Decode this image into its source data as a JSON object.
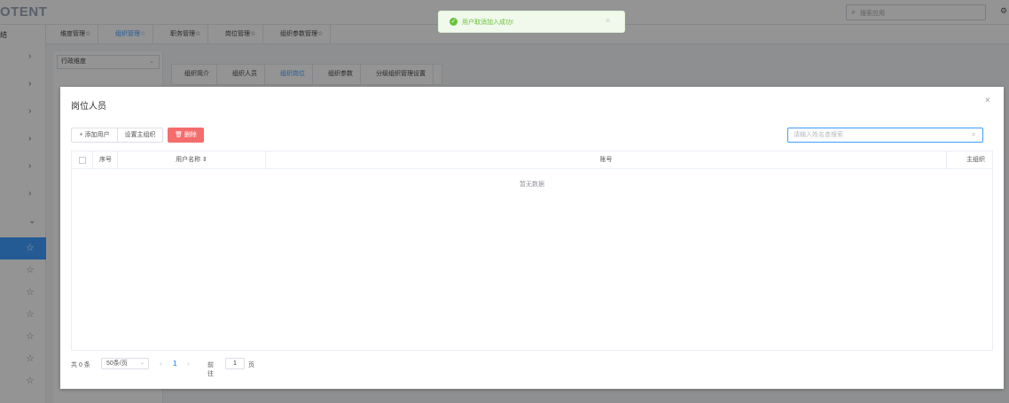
{
  "app": {
    "brand": "OTENT",
    "search_placeholder": "搜索应用",
    "sidebar_head": "结"
  },
  "tabs": [
    "维度管理☆",
    "组织管理☆",
    "职务管理☆",
    "岗位管理☆",
    "组织参数管理☆"
  ],
  "tabs_active": 1,
  "tree": {
    "select_value": "行政维度"
  },
  "inner_tabs": [
    "组织简介",
    "组织人员",
    "组织岗位",
    "组织参数",
    "分级组织管理设置"
  ],
  "inner_tabs_active": 2,
  "toast": {
    "message": "用户取消加入成功!"
  },
  "dialog": {
    "title": "岗位人员",
    "add_button": "+ 添加用户",
    "set_main_button": "设置主组织",
    "delete_button": "删除",
    "search_placeholder": "请输入姓名查搜索",
    "columns": [
      "序号",
      "用户名称 ⇕",
      "账号",
      "主组织"
    ],
    "empty_text": "暂无数据",
    "pager": {
      "total": "共 0 条",
      "page_size": "50条/页",
      "current_page": "1",
      "goto_label": "前往",
      "goto_value": "1",
      "goto_unit": "页"
    }
  },
  "colors": {
    "primary": "#409eff",
    "danger": "#f56c6c",
    "success": "#67c23a"
  }
}
